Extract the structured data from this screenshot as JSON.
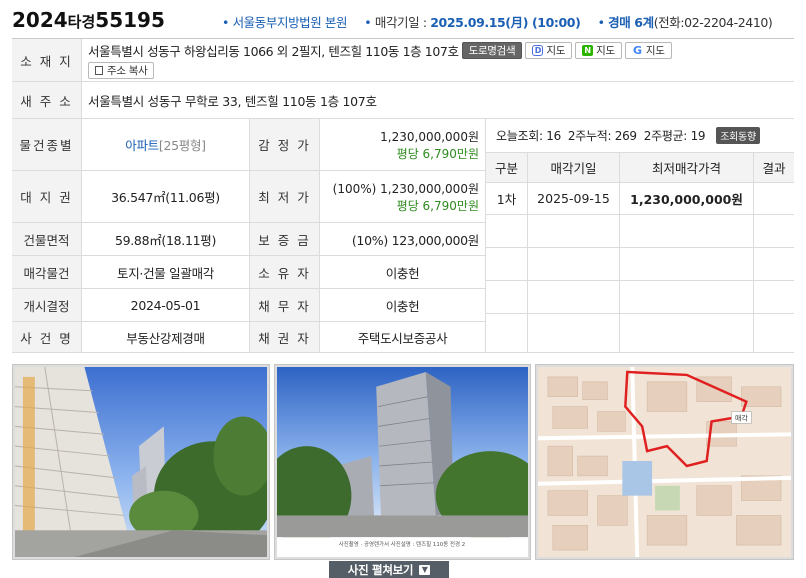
{
  "header": {
    "case_year": "2024",
    "case_kind": "타경",
    "case_number": "55195",
    "court": "서울동부지방법원 본원",
    "sale_date_label": "매각기일 :",
    "sale_date": "2025.09.15(月) (10:00)",
    "dept": "경매 6계",
    "phone": "(전화:02-2204-2410)"
  },
  "location": {
    "label": "소 재 지",
    "value": "서울특별시 성동구 하왕십리동 1066 외 2필지, 텐즈힐 110동 1층 107호",
    "road_search": "도로명검색",
    "map_daum": "지도",
    "map_naver": "지도",
    "map_google": "지도",
    "copy_address": "주소 복사"
  },
  "new_address": {
    "label": "새 주 소",
    "value": "서울특별시 성동구 무학로 33, 텐즈힐 110동 1층 107호"
  },
  "details": {
    "type_label": "물건종별",
    "type_value": "아파트",
    "type_size": "[25평형]",
    "appraisal_label": "감 정 가",
    "appraisal_value": "1,230,000,000원",
    "appraisal_per": "평당 6,790만원",
    "land_label": "대 지 권",
    "land_value": "36.547㎡(11.06평)",
    "min_label": "최 저 가",
    "min_value": "(100%) 1,230,000,000원",
    "min_per": "평당 6,790만원",
    "building_label": "건물면적",
    "building_value": "59.88㎡(18.11평)",
    "deposit_label": "보 증 금",
    "deposit_value": "(10%) 123,000,000원",
    "sale_item_label": "매각물건",
    "sale_item_value": "토지·건물 일괄매각",
    "owner_label": "소 유 자",
    "owner_value": "이충헌",
    "start_label": "개시결정",
    "start_value": "2024-05-01",
    "debtor_label": "채 무 자",
    "debtor_value": "이충헌",
    "case_name_label": "사 건 명",
    "case_name_value": "부동산강제경매",
    "creditor_label": "채 권 자",
    "creditor_value": "주택도시보증공사"
  },
  "views": {
    "today_label": "오늘조회:",
    "today": "16",
    "two_week_label": "2주누적:",
    "two_week": "269",
    "avg_label": "2주평균:",
    "avg": "19",
    "trend": "조회동향"
  },
  "bid_table": {
    "headers": [
      "구분",
      "매각기일",
      "최저매각가격",
      "결과"
    ],
    "rows": [
      [
        "1차",
        "2025-09-15",
        "1,230,000,000원",
        ""
      ]
    ]
  },
  "photos": {
    "caption": "사진촬영 · 공영렌가서 사진설명 : 텐즈힐 110동 전경 2"
  },
  "expand_button": "사진 펼쳐보기",
  "colors": {
    "accent_blue": "#1a5fb4",
    "price_green": "#2e8b1e",
    "label_bg": "#f3f3f3"
  }
}
